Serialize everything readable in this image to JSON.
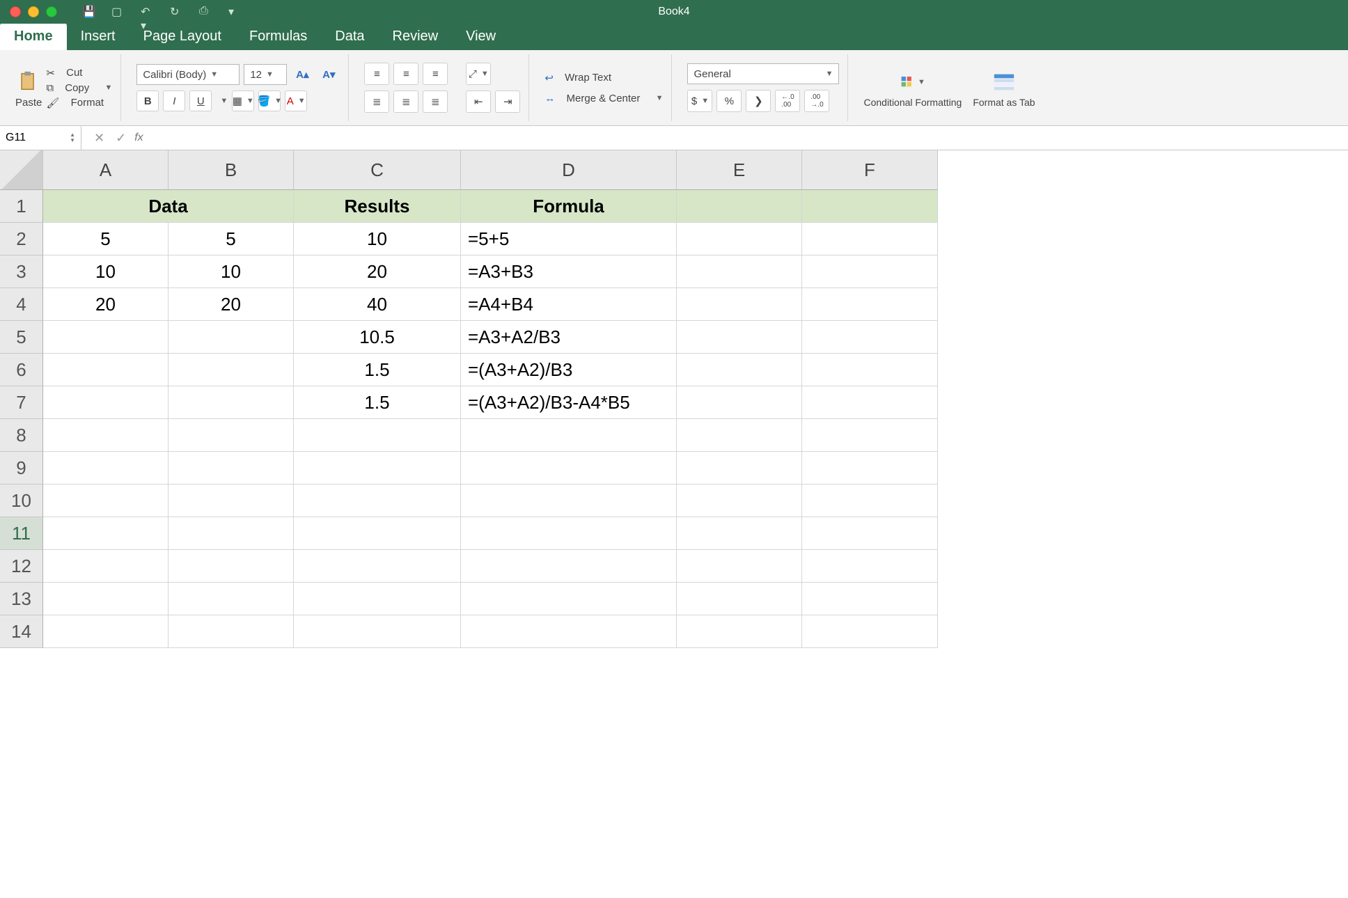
{
  "title": "Book4",
  "ribbon_tabs": [
    "Home",
    "Insert",
    "Page Layout",
    "Formulas",
    "Data",
    "Review",
    "View"
  ],
  "active_tab": "Home",
  "clipboard": {
    "paste": "Paste",
    "cut": "Cut",
    "copy": "Copy",
    "format": "Format"
  },
  "font": {
    "name": "Calibri (Body)",
    "size": "12",
    "bold": "B",
    "italic": "I",
    "underline": "U"
  },
  "alignment": {
    "wrap": "Wrap Text",
    "merge": "Merge & Center"
  },
  "number": {
    "format": "General",
    "currency": "$",
    "percent": "%",
    "comma": "❯",
    "inc": ".0",
    "dec": ".00"
  },
  "styles": {
    "cond": "Conditional Formatting",
    "tbl": "Format as Tab"
  },
  "namebox": "G11",
  "formula_bar": "",
  "columns": [
    "A",
    "B",
    "C",
    "D",
    "E",
    "F"
  ],
  "rows": [
    "1",
    "2",
    "3",
    "4",
    "5",
    "6",
    "7",
    "8",
    "9",
    "10",
    "11",
    "12",
    "13",
    "14"
  ],
  "selected_cell": {
    "row": 11,
    "col": 7
  },
  "headers_row1": {
    "AB": "Data",
    "C": "Results",
    "D": "Formula"
  },
  "data": {
    "A": {
      "2": "5",
      "3": "10",
      "4": "20"
    },
    "B": {
      "2": "5",
      "3": "10",
      "4": "20"
    },
    "C": {
      "2": "10",
      "3": "20",
      "4": "40",
      "5": "10.5",
      "6": "1.5",
      "7": "1.5"
    },
    "D": {
      "2": "=5+5",
      "3": "=A3+B3",
      "4": "=A4+B4",
      "5": "=A3+A2/B3",
      "6": "=(A3+A2)/B3",
      "7": "=(A3+A2)/B3-A4*B5"
    }
  }
}
